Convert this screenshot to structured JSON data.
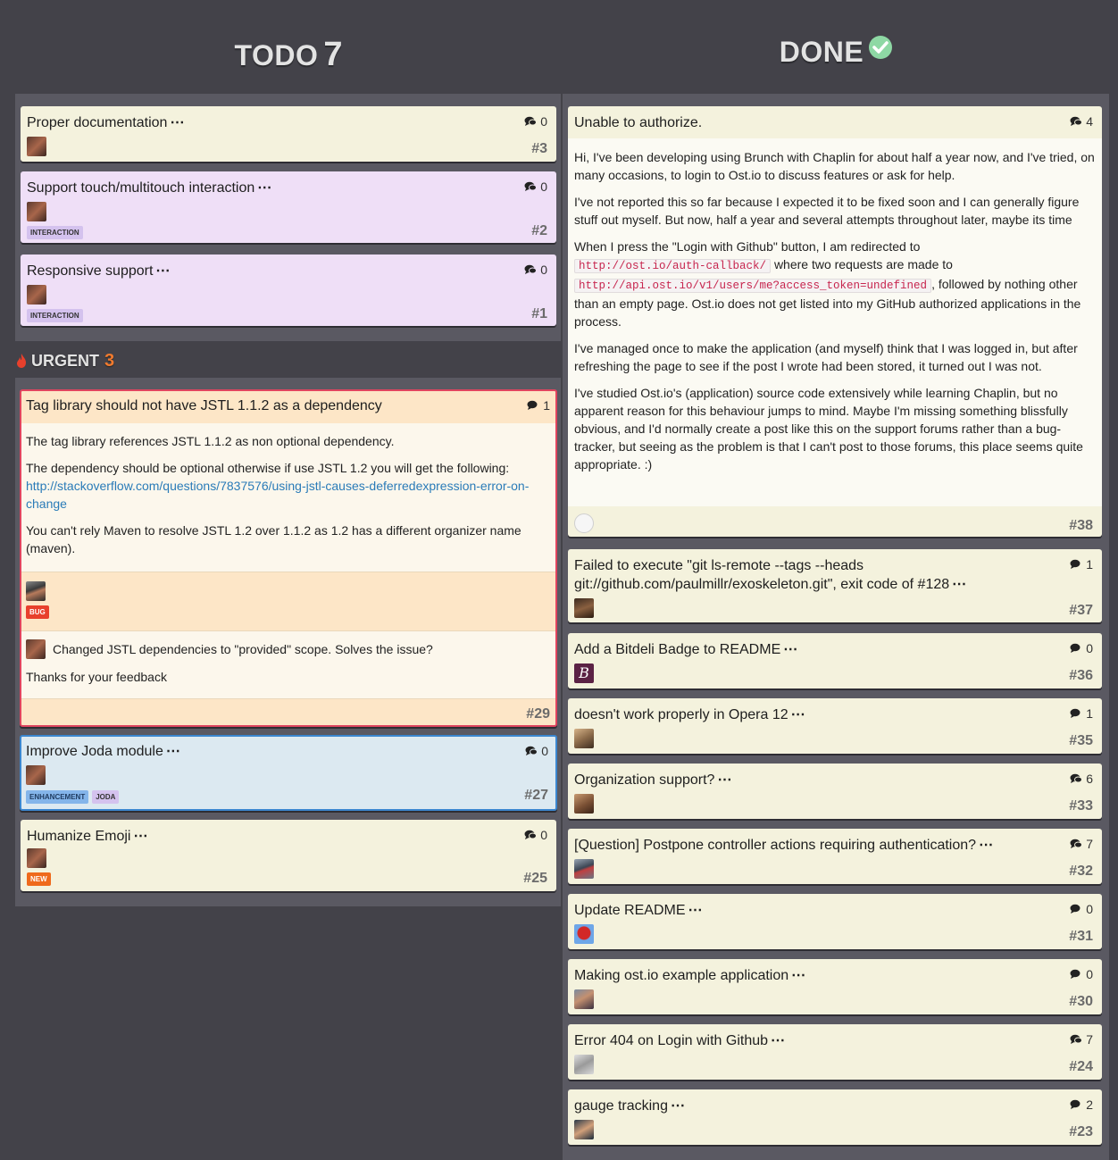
{
  "columns": {
    "todo": {
      "word": "TODO",
      "count": "7"
    },
    "done": {
      "word": "DONE"
    },
    "urgent": {
      "word": "URGENT",
      "count": "3"
    }
  },
  "todo_cards": [
    {
      "title": "Proper documentation",
      "comments": "0",
      "number": "#3",
      "labels": []
    },
    {
      "title": "Support touch/multitouch interaction",
      "comments": "0",
      "number": "#2",
      "labels": [
        "INTERACTION"
      ]
    },
    {
      "title": "Responsive support",
      "comments": "0",
      "number": "#1",
      "labels": [
        "INTERACTION"
      ]
    }
  ],
  "urgent_expanded": {
    "title": "Tag library should not have JSTL 1.1.2 as a dependency",
    "comments": "1",
    "number": "#29",
    "p1": "The tag library references JSTL 1.1.2 as non optional dependency.",
    "p2": "The dependency should be optional otherwise if use JSTL 1.2 you will get the following:",
    "link": "http://stackoverflow.com/questions/7837576/using-jstl-causes-deferredexpression-error-on-change",
    "p3": "You can't rely Maven to resolve JSTL 1.2 over 1.1.2 as 1.2 has a different organizer name (maven).",
    "label": "BUG",
    "reply1": "Changed JSTL dependencies to \"provided\" scope. Solves the issue?",
    "reply2": "Thanks for your feedback"
  },
  "urgent_cards": [
    {
      "title": "Improve Joda module",
      "comments": "0",
      "number": "#27",
      "labels": [
        "ENHANCEMENT",
        "JODA"
      ]
    },
    {
      "title": "Humanize Emoji",
      "comments": "0",
      "number": "#25",
      "labels": [
        "NEW"
      ]
    }
  ],
  "done_expanded": {
    "title": "Unable to authorize.",
    "comments": "4",
    "number": "#38",
    "p1": "Hi, I've been developing using Brunch with Chaplin for about half a year now, and I've tried, on many occasions, to login to Ost.io to discuss features or ask for help.",
    "p2": "I've not reported this so far because I expected it to be fixed soon and I can generally figure stuff out myself. But now, half a year and several attempts throughout later, maybe its time",
    "p3a": "When I press the \"Login with Github\" button, I am redirected to",
    "code1": "http://ost.io/auth-callback/",
    "p3b": "where two requests are made to",
    "code2": "http://api.ost.io/v1/users/me?access_token=undefined",
    "p3c": ", followed by nothing other than an empty page. Ost.io does not get listed into my GitHub authorized applications in the process.",
    "p4": "I've managed once to make the application (and myself) think that I was logged in, but after refreshing the page to see if the post I wrote had been stored, it turned out I was not.",
    "p5": "I've studied Ost.io's (application) source code extensively while learning Chaplin, but no apparent reason for this behaviour jumps to mind. Maybe I'm missing something blissfully obvious, and I'd normally create a post like this on the support forums rather than a bug-tracker, but seeing as the problem is that I can't post to those forums, this place seems quite appropriate. :)"
  },
  "done_cards": [
    {
      "title1": "Failed to execute \"git ls-remote --tags --heads",
      "title2": "git://github.com/paulmillr/exoskeleton.git\", exit code of #128",
      "comments": "1",
      "number": "#37"
    },
    {
      "title": "Add a Bitdeli Badge to README",
      "comments": "0",
      "number": "#36"
    },
    {
      "title": "doesn't work properly in Opera 12",
      "comments": "1",
      "number": "#35"
    },
    {
      "title": "Organization support?",
      "comments": "6",
      "number": "#33"
    },
    {
      "title": "[Question] Postpone controller actions requiring authentication?",
      "comments": "7",
      "number": "#32"
    },
    {
      "title": "Update README",
      "comments": "0",
      "number": "#31"
    },
    {
      "title": "Making ost.io example application",
      "comments": "0",
      "number": "#30"
    },
    {
      "title": "Error 404 on Login with Github",
      "comments": "7",
      "number": "#24"
    },
    {
      "title": "gauge tracking",
      "comments": "2",
      "number": "#23"
    }
  ],
  "ellipsis": "⋯",
  "bitdeli_glyph": "B"
}
